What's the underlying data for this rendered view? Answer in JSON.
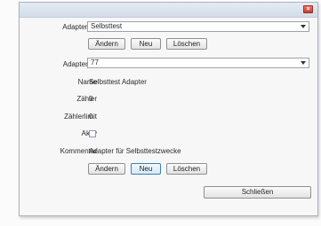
{
  "window": {
    "close_symbol": "×"
  },
  "adaptertyp": {
    "label": "Adaptertyp",
    "value": "Selbsttest",
    "buttons": {
      "aendern": "Ändern",
      "neu": "Neu",
      "loeschen": "Löschen"
    }
  },
  "adapter": {
    "id_label": "Adapter ID",
    "id_value": "77",
    "name_label": "Name",
    "name_value": "Selbsttest Adapter",
    "zaehler_label": "Zähler",
    "zaehler_value": "0",
    "zaehlerlimit_label": "Zählerlimit",
    "zaehlerlimit_value": "0",
    "aktiv_label": "Aktiv",
    "aktiv_checked": false,
    "kommentar_label": "Kommentar",
    "kommentar_value": "Adapter für Selbsttestzwecke",
    "buttons": {
      "aendern": "Ändern",
      "neu": "Neu",
      "loeschen": "Löschen"
    }
  },
  "footer": {
    "schliessen": "Schließen"
  }
}
